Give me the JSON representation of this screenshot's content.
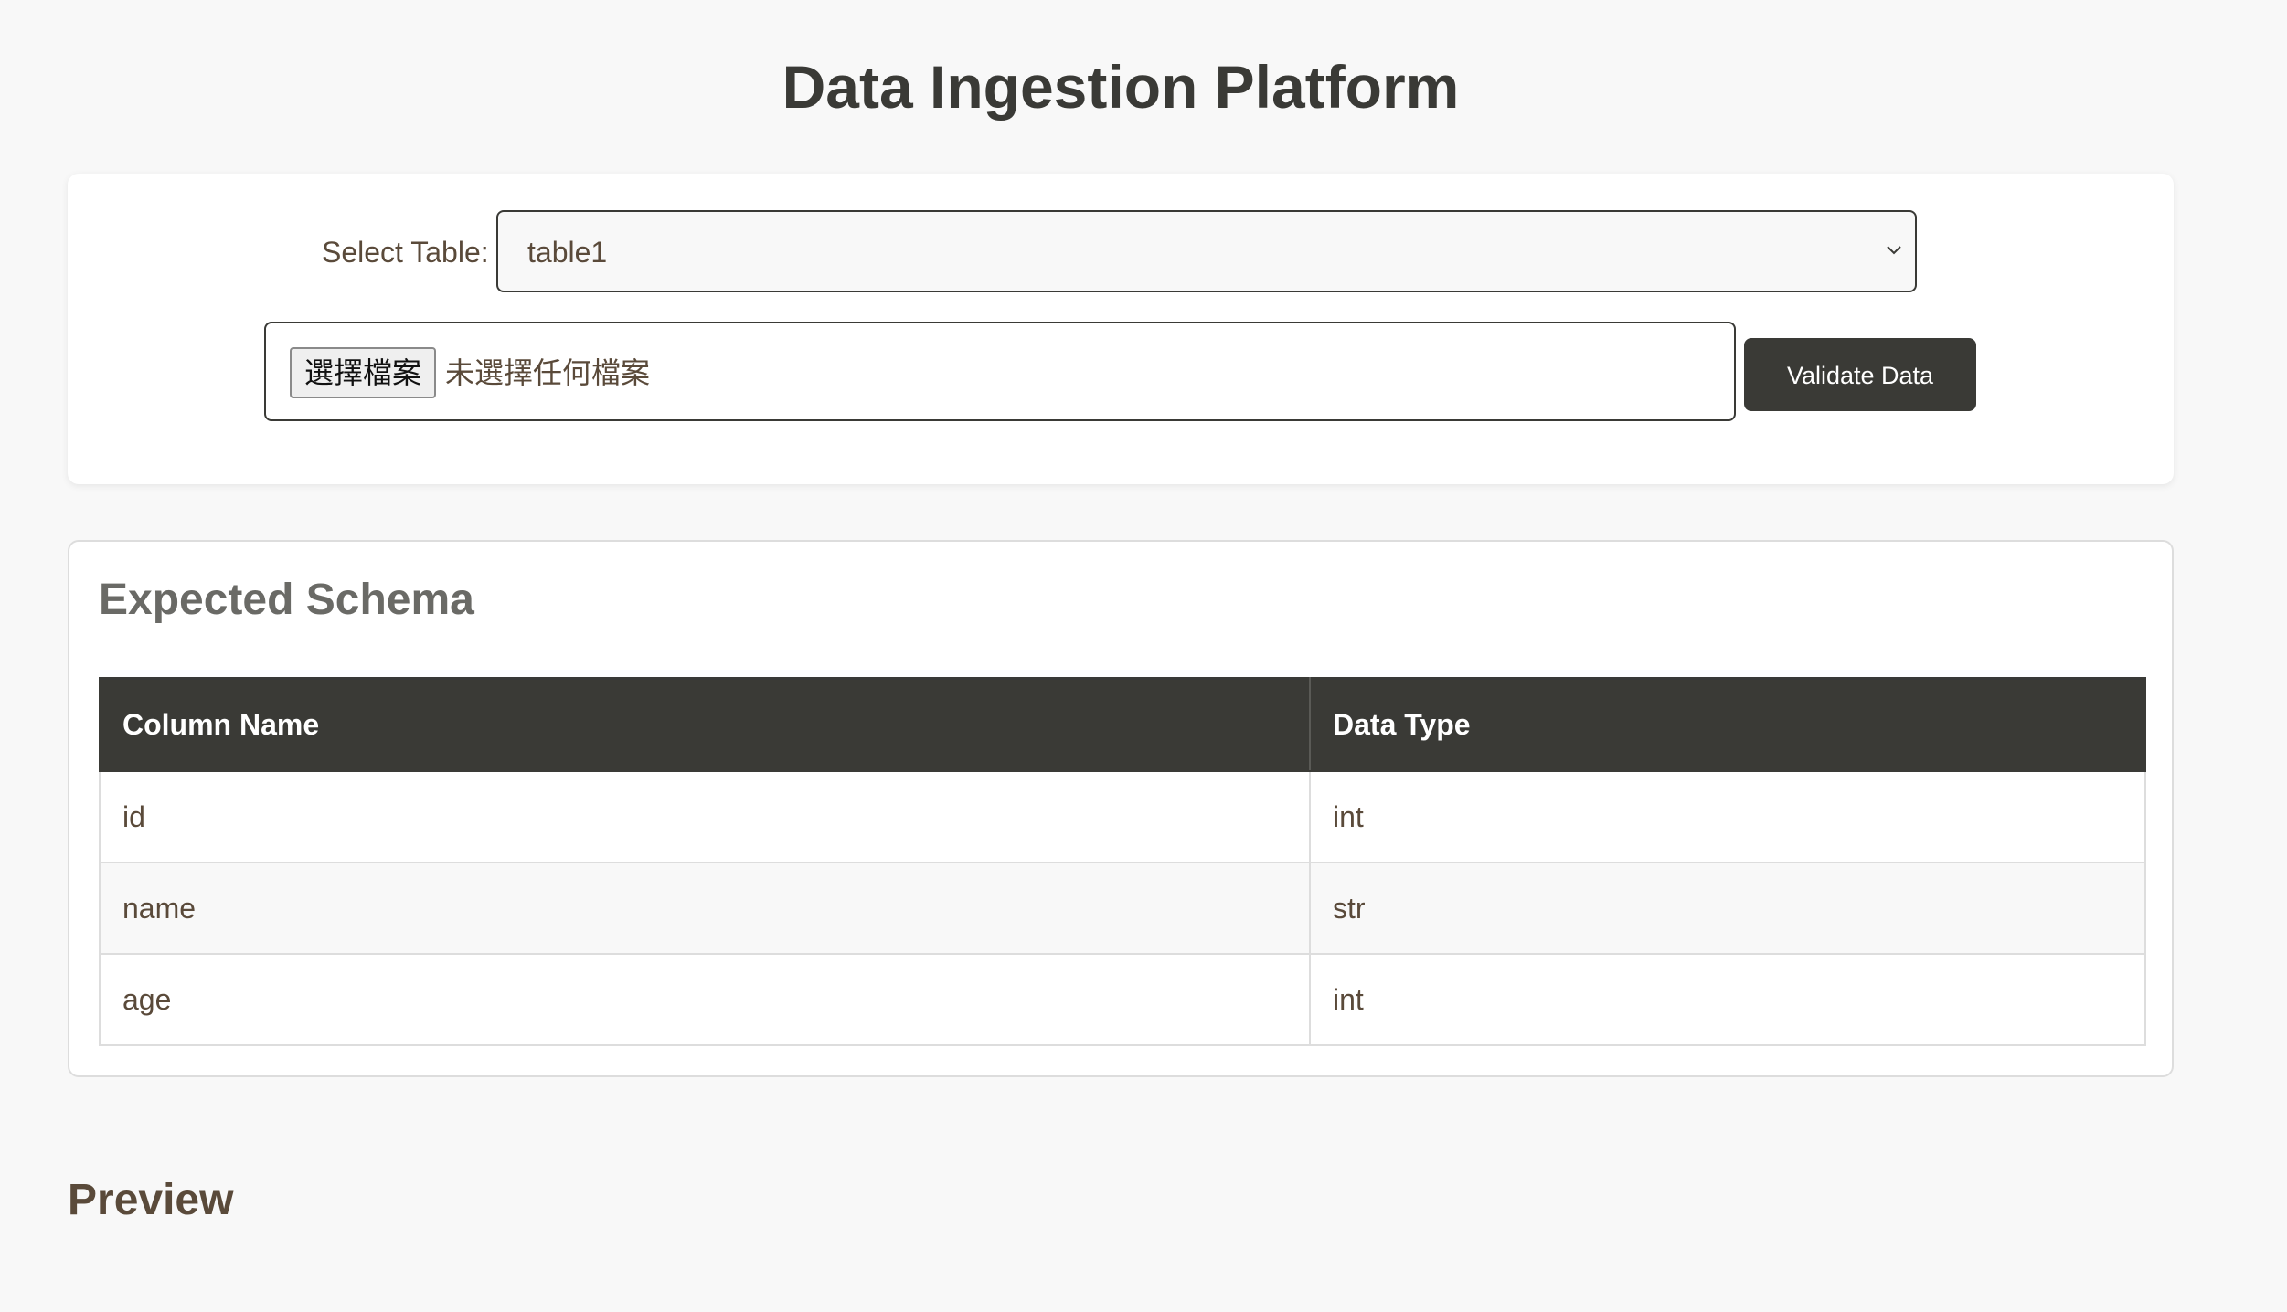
{
  "header": {
    "title": "Data Ingestion Platform"
  },
  "upload": {
    "select_label": "Select Table:",
    "selected_table": "table1",
    "file_button_label": "選擇檔案",
    "file_status": "未選擇任何檔案",
    "validate_label": "Validate Data"
  },
  "schema": {
    "title": "Expected Schema",
    "columns": [
      "Column Name",
      "Data Type"
    ],
    "rows": [
      {
        "name": "id",
        "type": "int"
      },
      {
        "name": "name",
        "type": "str"
      },
      {
        "name": "age",
        "type": "int"
      }
    ]
  },
  "preview": {
    "title": "Preview"
  },
  "colors": {
    "background": "#f8f8f8",
    "accent": "#3a3a36",
    "text": "#5a4a3a"
  },
  "icons": {
    "select_chevron": "chevron-down-icon"
  }
}
